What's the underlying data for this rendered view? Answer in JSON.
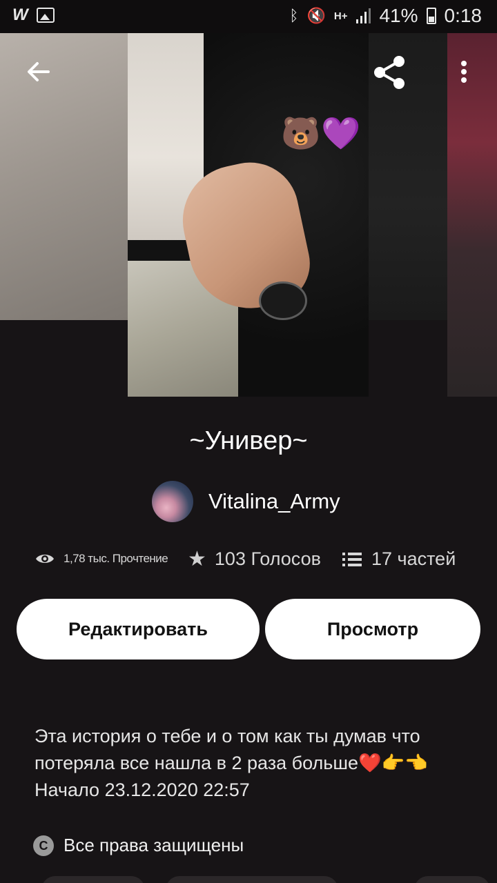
{
  "status_bar": {
    "app_icon_letter": "W",
    "battery": "41%",
    "time": "0:18",
    "network": "H+"
  },
  "toolbar": {
    "back_icon": "back-arrow-icon",
    "share_icon": "share-icon",
    "menu_icon": "more-vert-icon"
  },
  "cover": {
    "emoji_1": "🐻",
    "emoji_2": "💜"
  },
  "story": {
    "title": "~Универ~",
    "author": "Vitalina_Army",
    "stats": {
      "reads": "1,78 тыс. Прочтение",
      "votes": "103 Голосов",
      "parts": "17 частей"
    },
    "buttons": {
      "edit": "Редактировать",
      "view": "Просмотр"
    },
    "description": {
      "line1": "Эта история о тебе и о том как ты думав что",
      "line2": "потеряла все нашла в 2 раза больше❤️👉👈",
      "line3": "Начало 23.12.2020 22:57"
    },
    "copyright": "Все права защищены"
  },
  "colors": {
    "background": "#171416",
    "button_bg": "#ffffff",
    "button_text": "#121212"
  }
}
